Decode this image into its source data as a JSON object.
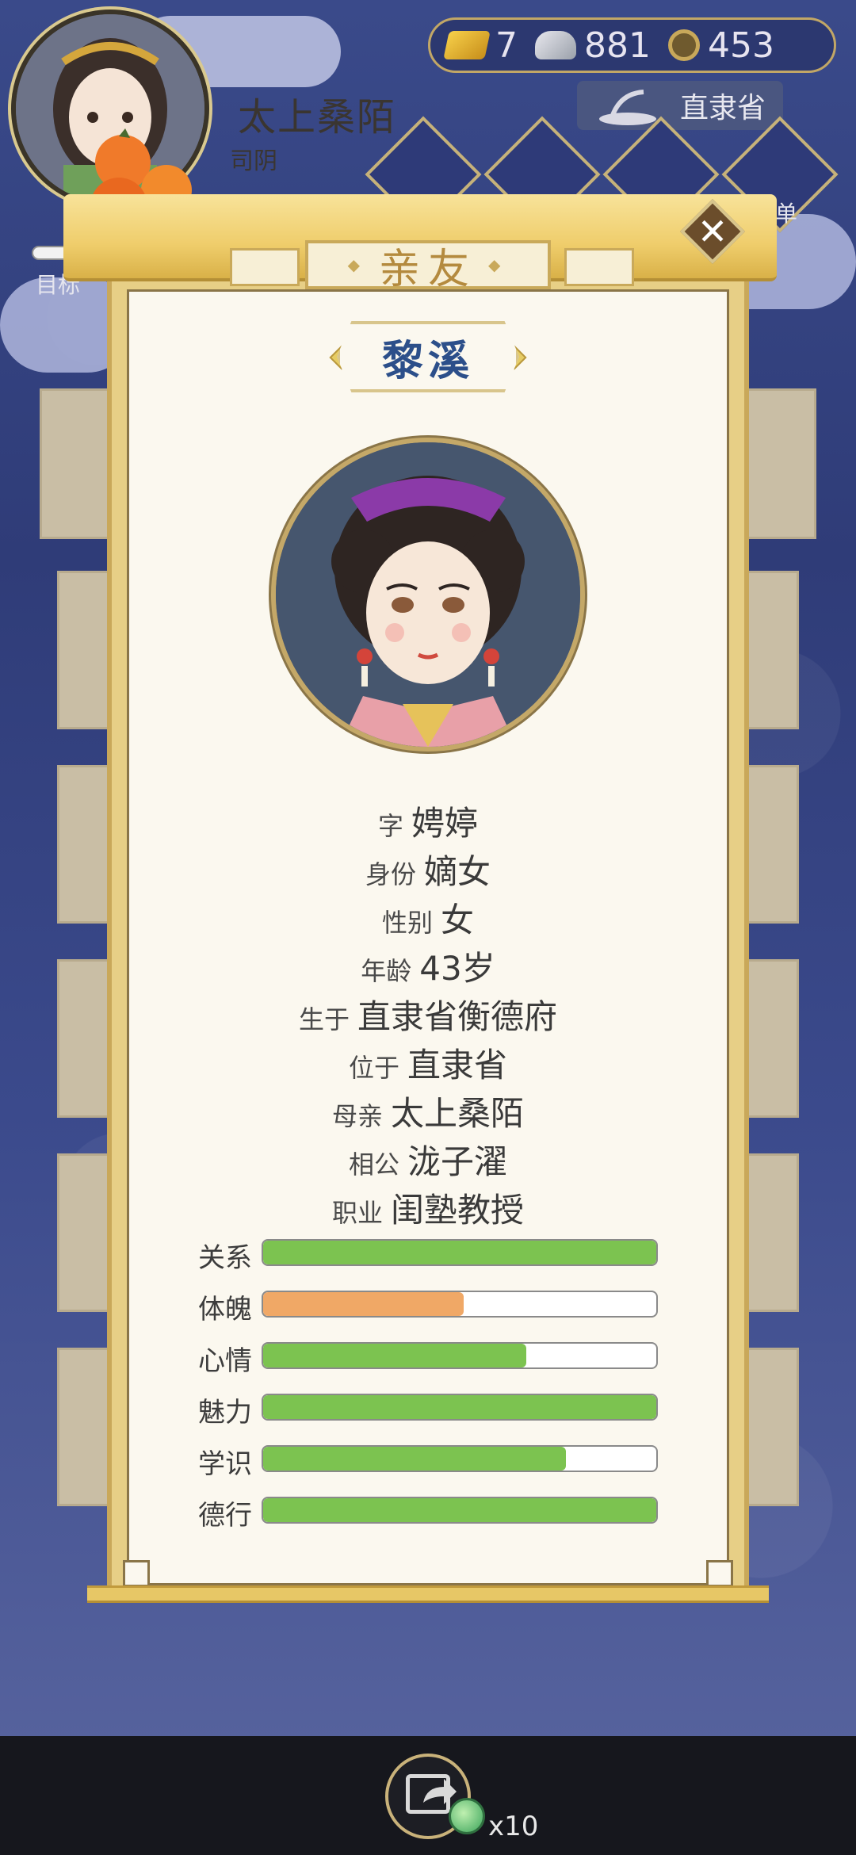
{
  "player": {
    "name": "太上桑陌",
    "title": "司阴",
    "target_label": "目标"
  },
  "currency": {
    "gold": "7",
    "silver": "881",
    "coins": "453"
  },
  "location": "直隶省",
  "side_label_right": "单",
  "panel": {
    "tab_title": "亲友",
    "close_label": "✕"
  },
  "person": {
    "name": "黎溪",
    "rows": [
      {
        "label": "字",
        "value": "娉婷"
      },
      {
        "label": "身份",
        "value": "嫡女"
      },
      {
        "label": "性别",
        "value": "女"
      },
      {
        "label": "年龄",
        "value": "43岁"
      },
      {
        "label": "生于",
        "value": "直隶省衡德府"
      },
      {
        "label": "位于",
        "value": "直隶省"
      },
      {
        "label": "母亲",
        "value": "太上桑陌"
      },
      {
        "label": "相公",
        "value": "泷子濯"
      },
      {
        "label": "职业",
        "value": "闺塾教授"
      }
    ],
    "stats": [
      {
        "label": "关系",
        "fill": 1.0,
        "color": "#7cc350"
      },
      {
        "label": "体魄",
        "fill": 0.51,
        "color": "#f0a866"
      },
      {
        "label": "心情",
        "fill": 0.67,
        "color": "#7cc350"
      },
      {
        "label": "魅力",
        "fill": 1.0,
        "color": "#7cc350"
      },
      {
        "label": "学识",
        "fill": 0.77,
        "color": "#7cc350"
      },
      {
        "label": "德行",
        "fill": 1.0,
        "color": "#7cc350"
      }
    ]
  },
  "footer": {
    "reward_count": "x10"
  },
  "icons": {
    "gold": "gold-ingot-icon",
    "silver": "silver-ingot-icon",
    "coin": "copper-coin-icon",
    "location": "location-icon",
    "share": "share-icon",
    "reward": "jade-coin-icon"
  }
}
